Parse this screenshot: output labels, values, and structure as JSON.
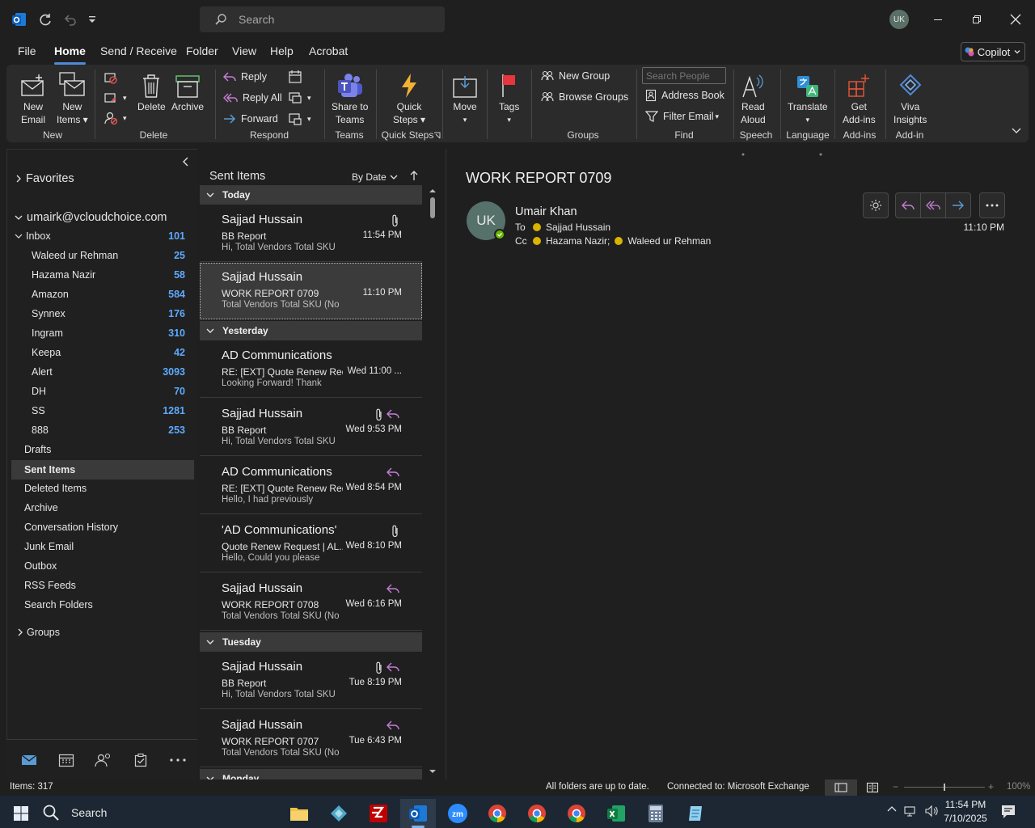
{
  "titlebar": {
    "search_placeholder": "Search",
    "avatar_initials": "UK"
  },
  "menu": {
    "tabs": [
      "File",
      "Home",
      "Send / Receive",
      "Folder",
      "View",
      "Help",
      "Acrobat"
    ],
    "active": "Home",
    "copilot_label": "Copilot"
  },
  "ribbon": {
    "new_email": [
      "New",
      "Email"
    ],
    "new_items": [
      "New",
      "Items"
    ],
    "group_new": "New",
    "delete": "Delete",
    "archive": "Archive",
    "group_delete": "Delete",
    "reply": "Reply",
    "reply_all": "Reply All",
    "forward": "Forward",
    "group_respond": "Respond",
    "share_teams": [
      "Share to",
      "Teams"
    ],
    "group_teams": "Teams",
    "quick_steps": [
      "Quick",
      "Steps"
    ],
    "group_quick_steps": "Quick Steps",
    "move": "Move",
    "tags": "Tags",
    "new_group": "New Group",
    "browse_groups": "Browse Groups",
    "group_groups": "Groups",
    "search_people_placeholder": "Search People",
    "address_book": "Address Book",
    "filter_email": "Filter Email",
    "group_find": "Find",
    "read_aloud": [
      "Read",
      "Aloud"
    ],
    "group_speech": "Speech",
    "translate": "Translate",
    "group_language": "Language",
    "get_addins": [
      "Get",
      "Add-ins"
    ],
    "group_addins": "Add-ins",
    "viva_insights": [
      "Viva",
      "Insights"
    ],
    "group_addin": "Add-in"
  },
  "nav": {
    "favorites": "Favorites",
    "account": "umairk@vcloudchoice.com",
    "inbox": {
      "label": "Inbox",
      "count": "101"
    },
    "inbox_folders": [
      {
        "label": "Waleed ur Rehman",
        "count": "25"
      },
      {
        "label": "Hazama Nazir",
        "count": "58"
      },
      {
        "label": "Amazon",
        "count": "584"
      },
      {
        "label": "Synnex",
        "count": "176"
      },
      {
        "label": "Ingram",
        "count": "310"
      },
      {
        "label": "Keepa",
        "count": "42"
      },
      {
        "label": "Alert",
        "count": "3093"
      },
      {
        "label": "DH",
        "count": "70"
      },
      {
        "label": "SS",
        "count": "1281"
      },
      {
        "label": "888",
        "count": "253"
      }
    ],
    "folders": [
      "Drafts",
      "Sent Items",
      "Deleted Items",
      "Archive",
      "Conversation History",
      "Junk Email",
      "Outbox",
      "RSS Feeds",
      "Search Folders"
    ],
    "selected_folder": "Sent Items",
    "groups": "Groups"
  },
  "list": {
    "title": "Sent Items",
    "sort": "By Date",
    "groups": {
      "today": "Today",
      "yesterday": "Yesterday",
      "tuesday": "Tuesday",
      "monday": "Monday"
    },
    "messages": [
      {
        "from": "Sajjad Hussain",
        "subject": "BB Report",
        "preview": "Hi,  Total Vendors  Total SKU",
        "time": "11:54 PM"
      },
      {
        "from": "Sajjad Hussain",
        "subject": "WORK REPORT 0709",
        "preview": "Total Vendors  Total SKU (No",
        "time": "11:10 PM"
      },
      {
        "from": "AD Communications",
        "subject": "RE: [EXT] Quote Renew Req...",
        "preview": "Looking Forward!  Thank",
        "time": "Wed 11:00 ..."
      },
      {
        "from": "Sajjad Hussain",
        "subject": "BB Report",
        "preview": "Hi,  Total Vendors  Total SKU",
        "time": "Wed 9:53 PM"
      },
      {
        "from": "AD Communications",
        "subject": "RE: [EXT] Quote Renew Req...",
        "preview": "Hello,  I had previously",
        "time": "Wed 8:54 PM"
      },
      {
        "from": "'AD Communications'",
        "subject": "Quote Renew Request | AL...",
        "preview": "Hello,  Could you please",
        "time": "Wed 8:10 PM"
      },
      {
        "from": "Sajjad Hussain",
        "subject": "WORK REPORT 0708",
        "preview": "Total Vendors  Total SKU (No",
        "time": "Wed 6:16 PM"
      },
      {
        "from": "Sajjad Hussain",
        "subject": "BB Report",
        "preview": "Hi,  Total Vendors  Total SKU",
        "time": "Tue 8:19 PM"
      },
      {
        "from": "Sajjad Hussain",
        "subject": "WORK REPORT 0707",
        "preview": "Total Vendors  Total SKU (No",
        "time": "Tue 6:43 PM"
      }
    ]
  },
  "reading": {
    "subject": "WORK REPORT 0709",
    "avatar_initials": "UK",
    "sender": "Umair Khan",
    "to_label": "To",
    "to": "Sajjad Hussain",
    "cc_label": "Cc",
    "cc1": "Hazama Nazir;",
    "cc2": "Waleed ur Rehman",
    "time": "11:10 PM"
  },
  "status": {
    "items": "Items: 317",
    "sync": "All folders are up to date.",
    "connection": "Connected to: Microsoft Exchange",
    "zoom": "100%"
  },
  "taskbar": {
    "search": "Search",
    "time": "11:54 PM",
    "date": "7/10/2025"
  },
  "colors": {
    "accent": "#4f8ad8",
    "count_blue": "#5ea9ff",
    "reply_purple": "#c77dd6",
    "forward_blue": "#5b9bd5"
  }
}
